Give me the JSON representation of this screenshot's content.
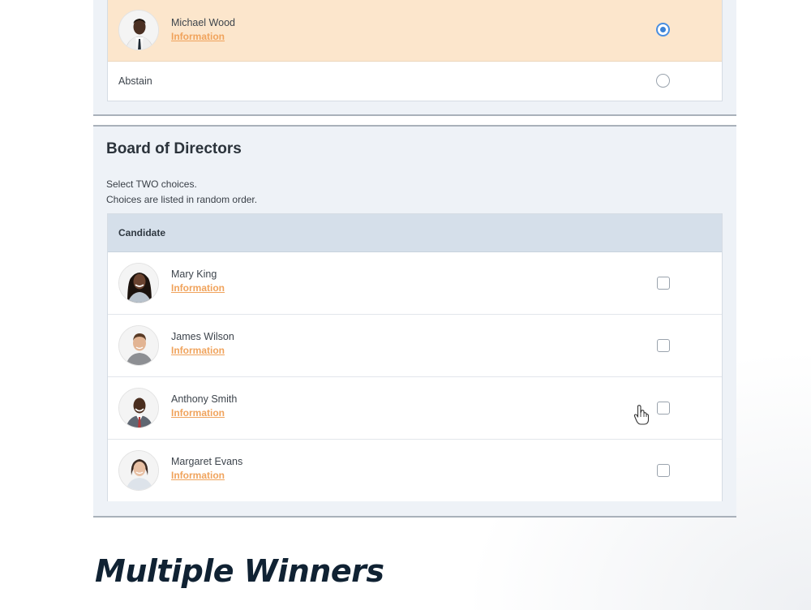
{
  "previous_ballot": {
    "selected_candidate": {
      "name": "Michael Wood",
      "info_link": "Information",
      "selected": true
    },
    "abstain_label": "Abstain"
  },
  "board_section": {
    "title": "Board of Directors",
    "instructions": [
      "Select TWO choices.",
      "Choices are listed in random order."
    ],
    "column_header": "Candidate",
    "candidates": [
      {
        "name": "Mary King",
        "info_link": "Information",
        "checked": false
      },
      {
        "name": "James Wilson",
        "info_link": "Information",
        "checked": false
      },
      {
        "name": "Anthony Smith",
        "info_link": "Information",
        "checked": false
      },
      {
        "name": "Margaret Evans",
        "info_link": "Information",
        "checked": false
      }
    ]
  },
  "caption": "Multiple Winners",
  "colors": {
    "section_bg": "#eef2f7",
    "header_bg": "#d5dfea",
    "selected_row_bg": "#fce6cc",
    "link": "#f0a35c",
    "radio_selected": "#3b82d6",
    "caption": "#102233"
  },
  "icons": {
    "pointer": "hand-pointer-icon"
  }
}
